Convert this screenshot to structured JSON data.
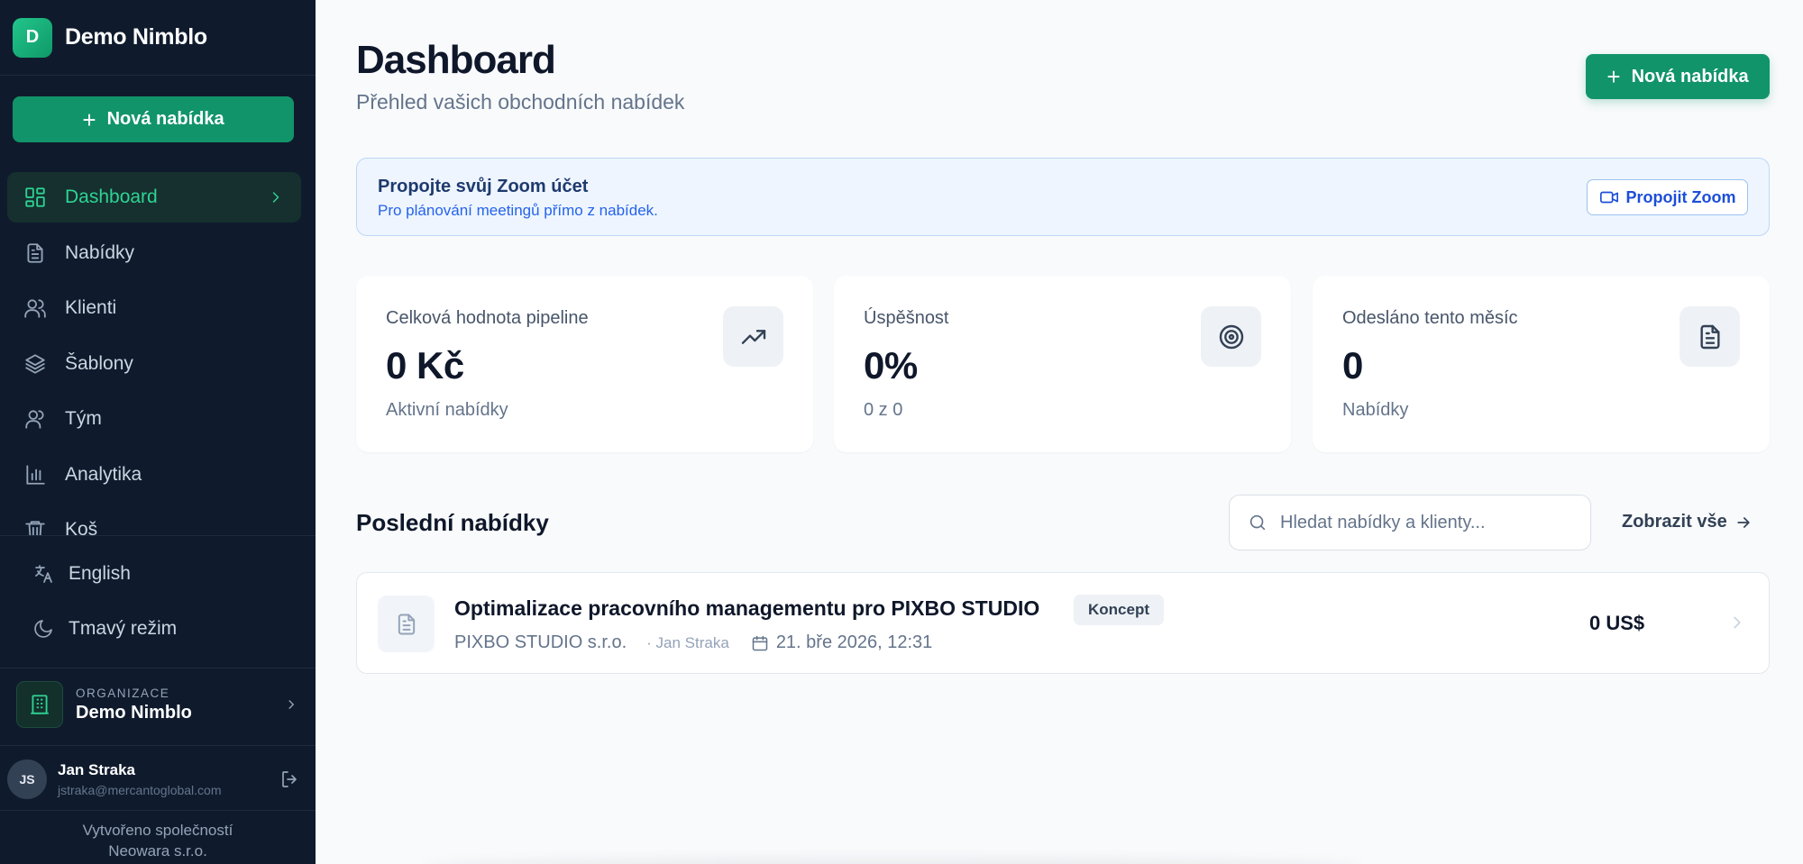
{
  "sidebar": {
    "brand": {
      "logo_letter": "D",
      "name": "Demo Nimblo"
    },
    "new_offer_label": "Nová nabídka",
    "items": [
      {
        "label": "Dashboard",
        "icon": "dashboard-icon",
        "active": true
      },
      {
        "label": "Nabídky",
        "icon": "document-icon"
      },
      {
        "label": "Klienti",
        "icon": "users-icon"
      },
      {
        "label": "Šablony",
        "icon": "layers-icon"
      },
      {
        "label": "Tým",
        "icon": "team-icon"
      },
      {
        "label": "Analytika",
        "icon": "bar-chart-icon"
      },
      {
        "label": "Koš",
        "icon": "trash-icon"
      }
    ],
    "language_label": "English",
    "dark_mode_label": "Tmavý režim",
    "organization": {
      "caption": "ORGANIZACE",
      "name": "Demo Nimblo"
    },
    "user": {
      "initials": "JS",
      "name": "Jan Straka",
      "email": "jstraka@mercantoglobal.com"
    },
    "credit_line1": "Vytvořeno společností",
    "credit_line2": "Neowara s.r.o."
  },
  "header": {
    "title": "Dashboard",
    "subtitle": "Přehled vašich obchodních nabídek",
    "new_offer_label": "Nová nabídka"
  },
  "zoom_banner": {
    "title": "Propojte svůj Zoom účet",
    "description": "Pro plánování meetingů přímo z nabídek.",
    "button_label": "Propojit Zoom"
  },
  "stats": [
    {
      "label": "Celková hodnota pipeline",
      "value": "0 Kč",
      "note": "Aktivní nabídky",
      "icon": "trending-up-icon"
    },
    {
      "label": "Úspěšnost",
      "value": "0%",
      "note": "0 z 0",
      "icon": "target-icon"
    },
    {
      "label": "Odesláno tento měsíc",
      "value": "0",
      "note": "Nabídky",
      "icon": "document-icon"
    }
  ],
  "recent": {
    "title": "Poslední nabídky",
    "search_placeholder": "Hledat nabídky a klienty...",
    "view_all_label": "Zobrazit vše",
    "offers": [
      {
        "title": "Optimalizace pracovního managementu pro PIXBO STUDIO",
        "status": "Koncept",
        "client": "PIXBO STUDIO s.r.o.",
        "author": "· Jan Straka",
        "date": "21. bře 2026, 12:31",
        "price": "0 US$"
      }
    ]
  },
  "colors": {
    "accent": "#12946a",
    "sidebar_bg": "#0f1b2d",
    "active_text": "#2fd394",
    "info_blue": "#2563eb"
  }
}
